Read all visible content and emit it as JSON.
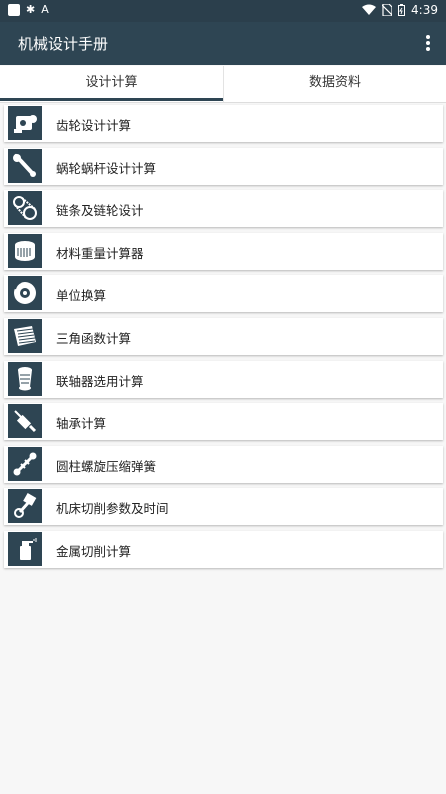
{
  "status": {
    "time": "4:39",
    "icons": [
      "square-icon",
      "bug-icon",
      "font-icon",
      "wifi-icon",
      "no-sim-icon",
      "battery-icon"
    ]
  },
  "app": {
    "title": "机械设计手册"
  },
  "tabs": [
    {
      "label": "设计计算",
      "selected": true
    },
    {
      "label": "数据资料",
      "selected": false
    }
  ],
  "items": [
    {
      "label": "齿轮设计计算",
      "icon": "gear-engine-icon"
    },
    {
      "label": "蜗轮蜗杆设计计算",
      "icon": "wrench-icon"
    },
    {
      "label": "链条及链轮设计",
      "icon": "chain-drive-icon"
    },
    {
      "label": "材料重量计算器",
      "icon": "filter-drum-icon"
    },
    {
      "label": "单位换算",
      "icon": "brake-disc-icon"
    },
    {
      "label": "三角函数计算",
      "icon": "grille-icon"
    },
    {
      "label": "联轴器选用计算",
      "icon": "coupling-filter-icon"
    },
    {
      "label": "轴承计算",
      "icon": "spark-plug-icon"
    },
    {
      "label": "圆柱螺旋压缩弹簧",
      "icon": "shaft-icon"
    },
    {
      "label": "机床切削参数及时间",
      "icon": "piston-icon"
    },
    {
      "label": "金属切削计算",
      "icon": "spray-bottle-icon"
    }
  ],
  "colors": {
    "appbar": "#2e4553",
    "statusbar": "#2b3f4c",
    "background": "#f7f7f7"
  }
}
